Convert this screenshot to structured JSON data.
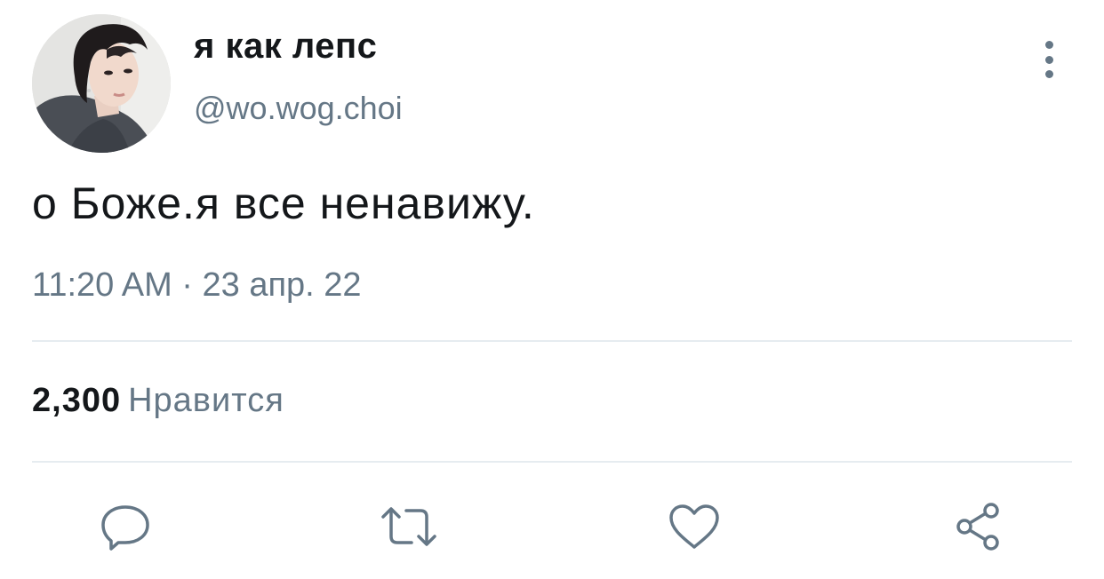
{
  "user": {
    "display_name": "я как лепс",
    "handle": "@wo.wog.choi",
    "avatar_icon": "profile-photo"
  },
  "tweet": {
    "text": "о Боже.я все ненавижу.",
    "timestamp": "11:20 AM · 23 апр. 22"
  },
  "stats": {
    "likes_count": "2,300",
    "likes_label": "Нравится"
  },
  "actions": {
    "reply_icon": "speech-bubble",
    "retweet_icon": "retweet-arrows",
    "like_icon": "heart",
    "share_icon": "share-nodes",
    "more_icon": "vertical-ellipsis"
  },
  "colors": {
    "text_primary": "#14171a",
    "text_secondary": "#657786",
    "divider": "#e6ecf0",
    "background": "#ffffff"
  }
}
